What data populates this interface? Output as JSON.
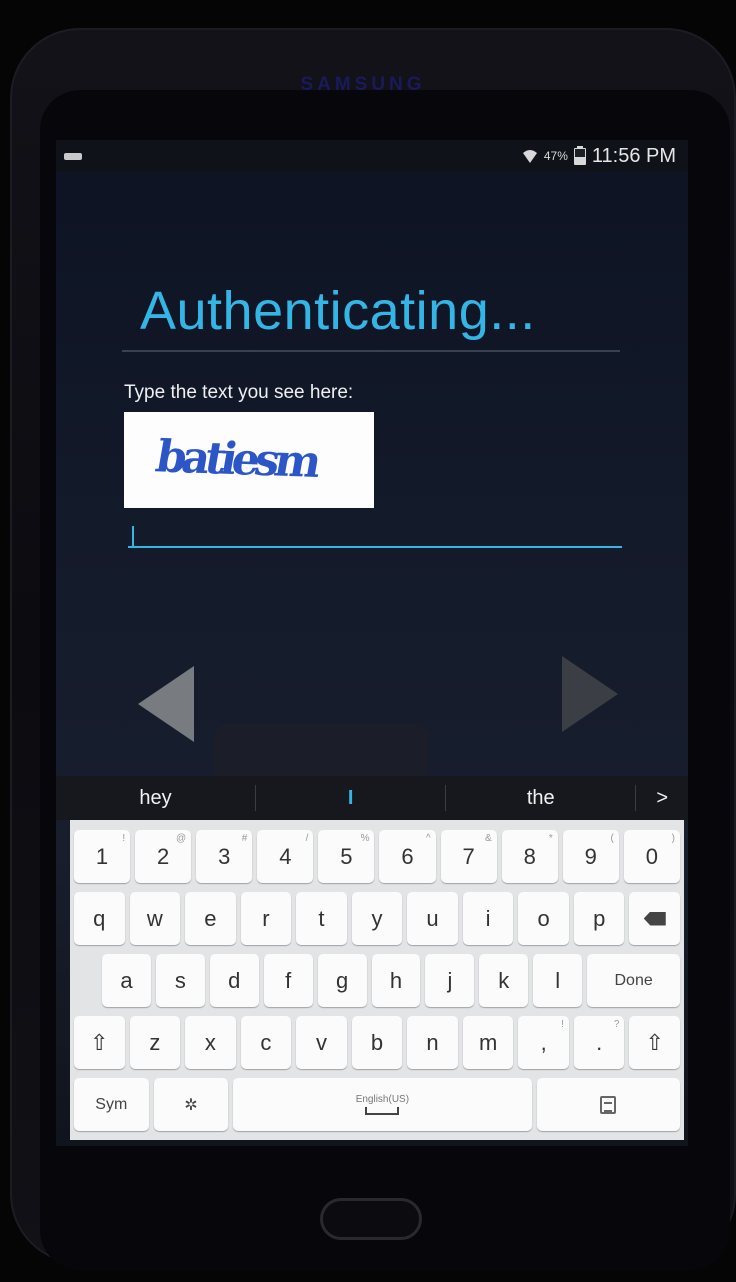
{
  "device": {
    "brand": "SAMSUNG"
  },
  "status_bar": {
    "battery_percent": "47%",
    "time": "11:56 PM"
  },
  "auth": {
    "title": "Authenticating...",
    "prompt": "Type the text you see here:",
    "captcha_text": "batiesm",
    "input_value": ""
  },
  "suggestions": {
    "left": "hey",
    "middle": "I",
    "right": "the",
    "more": ">"
  },
  "keyboard": {
    "row_numbers": [
      {
        "key": "1",
        "hint": "!"
      },
      {
        "key": "2",
        "hint": "@"
      },
      {
        "key": "3",
        "hint": "#"
      },
      {
        "key": "4",
        "hint": "/"
      },
      {
        "key": "5",
        "hint": "%"
      },
      {
        "key": "6",
        "hint": "^"
      },
      {
        "key": "7",
        "hint": "&"
      },
      {
        "key": "8",
        "hint": "*"
      },
      {
        "key": "9",
        "hint": "("
      },
      {
        "key": "0",
        "hint": ")"
      }
    ],
    "row_q": [
      "q",
      "w",
      "e",
      "r",
      "t",
      "y",
      "u",
      "i",
      "o",
      "p"
    ],
    "row_a": [
      "a",
      "s",
      "d",
      "f",
      "g",
      "h",
      "j",
      "k",
      "l"
    ],
    "done_label": "Done",
    "row_z": [
      "z",
      "x",
      "c",
      "v",
      "b",
      "n",
      "m"
    ],
    "comma_key": ",",
    "comma_hint": "!",
    "period_key": ".",
    "period_hint": "?",
    "shift_symbol": "⇧",
    "sym_label": "Sym",
    "settings_symbol": "✲",
    "space_language": "English(US)"
  },
  "colors": {
    "accent": "#33b5e5",
    "screen_bg": "#141b2b",
    "keyboard_bg": "#e3e4e6"
  }
}
